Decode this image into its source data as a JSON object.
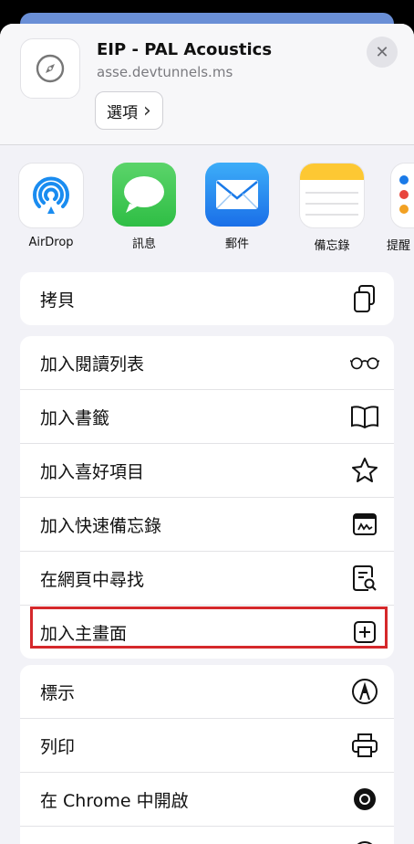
{
  "header": {
    "title": "EIP - PAL Acoustics",
    "url": "asse.devtunnels.ms",
    "options_label": "選項",
    "options_chevron": "›",
    "close_glyph": "✕"
  },
  "apps": [
    {
      "label": "AirDrop",
      "icon": "airdrop-icon"
    },
    {
      "label": "訊息",
      "icon": "messages-icon"
    },
    {
      "label": "郵件",
      "icon": "mail-icon"
    },
    {
      "label": "備忘錄",
      "icon": "notes-icon"
    },
    {
      "label": "提醒",
      "icon": "reminders-icon"
    }
  ],
  "group1": [
    {
      "label": "拷貝",
      "icon": "copy-icon"
    }
  ],
  "group2": [
    {
      "label": "加入閱讀列表",
      "icon": "glasses-icon"
    },
    {
      "label": "加入書籤",
      "icon": "book-icon"
    },
    {
      "label": "加入喜好項目",
      "icon": "star-icon"
    },
    {
      "label": "加入快速備忘錄",
      "icon": "quick-note-icon"
    },
    {
      "label": "在網頁中尋找",
      "icon": "find-in-page-icon"
    },
    {
      "label": "加入主畫面",
      "icon": "add-square-icon"
    }
  ],
  "group3": [
    {
      "label": "標示",
      "icon": "markup-icon"
    },
    {
      "label": "列印",
      "icon": "printer-icon"
    },
    {
      "label": "在 Chrome 中開啟",
      "icon": "chrome-icon"
    },
    {
      "label": "",
      "icon": "unknown-icon"
    }
  ],
  "highlight_color": "#d5282b"
}
